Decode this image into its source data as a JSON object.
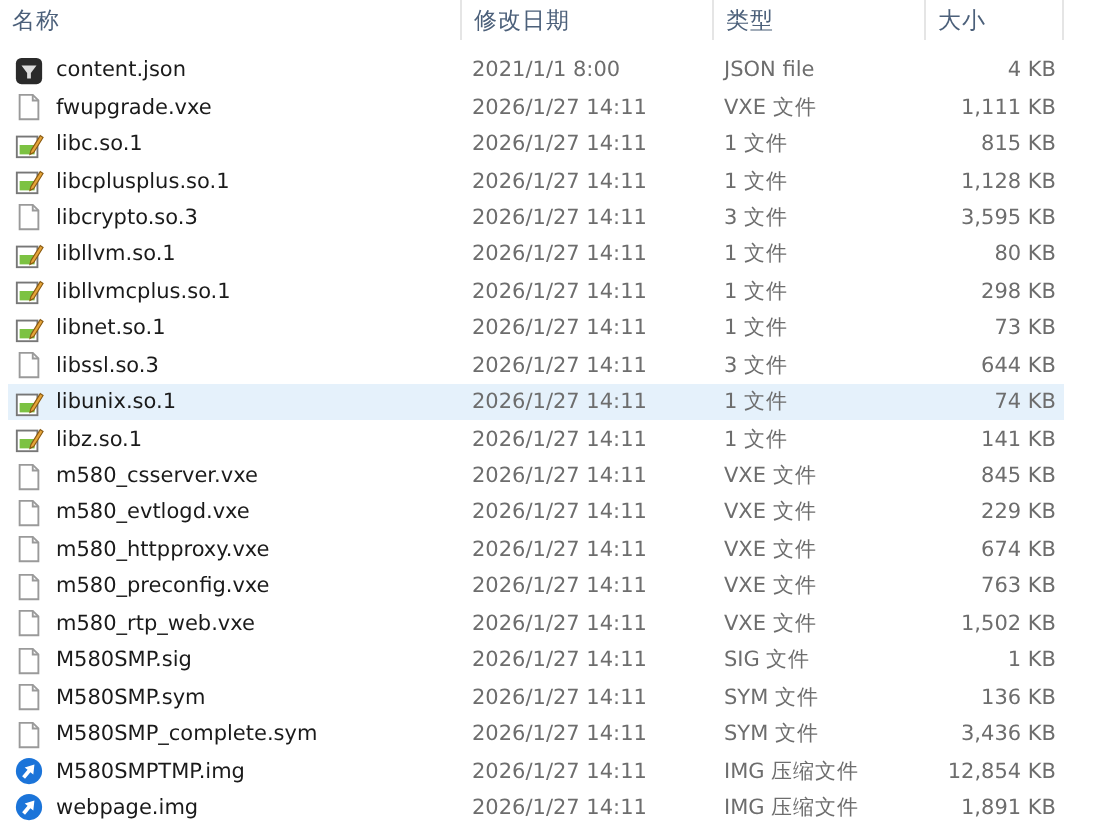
{
  "columns": [
    "名称",
    "修改日期",
    "类型",
    "大小"
  ],
  "rows": [
    {
      "kind": "json",
      "name": "content.json",
      "date": "2021/1/1 8:00",
      "type": "JSON file",
      "size": "4 KB",
      "selected": false
    },
    {
      "kind": "file",
      "name": "fwupgrade.vxe",
      "date": "2026/1/27 14:11",
      "type": "VXE 文件",
      "size": "1,111 KB",
      "selected": false
    },
    {
      "kind": "text",
      "name": "libc.so.1",
      "date": "2026/1/27 14:11",
      "type": "1 文件",
      "size": "815 KB",
      "selected": false
    },
    {
      "kind": "text",
      "name": "libcplusplus.so.1",
      "date": "2026/1/27 14:11",
      "type": "1 文件",
      "size": "1,128 KB",
      "selected": false
    },
    {
      "kind": "file",
      "name": "libcrypto.so.3",
      "date": "2026/1/27 14:11",
      "type": "3 文件",
      "size": "3,595 KB",
      "selected": false
    },
    {
      "kind": "text",
      "name": "libllvm.so.1",
      "date": "2026/1/27 14:11",
      "type": "1 文件",
      "size": "80 KB",
      "selected": false
    },
    {
      "kind": "text",
      "name": "libllvmcplus.so.1",
      "date": "2026/1/27 14:11",
      "type": "1 文件",
      "size": "298 KB",
      "selected": false
    },
    {
      "kind": "text",
      "name": "libnet.so.1",
      "date": "2026/1/27 14:11",
      "type": "1 文件",
      "size": "73 KB",
      "selected": false
    },
    {
      "kind": "file",
      "name": "libssl.so.3",
      "date": "2026/1/27 14:11",
      "type": "3 文件",
      "size": "644 KB",
      "selected": false
    },
    {
      "kind": "text",
      "name": "libunix.so.1",
      "date": "2026/1/27 14:11",
      "type": "1 文件",
      "size": "74 KB",
      "selected": true
    },
    {
      "kind": "text",
      "name": "libz.so.1",
      "date": "2026/1/27 14:11",
      "type": "1 文件",
      "size": "141 KB",
      "selected": false
    },
    {
      "kind": "file",
      "name": "m580_csserver.vxe",
      "date": "2026/1/27 14:11",
      "type": "VXE 文件",
      "size": "845 KB",
      "selected": false
    },
    {
      "kind": "file",
      "name": "m580_evtlogd.vxe",
      "date": "2026/1/27 14:11",
      "type": "VXE 文件",
      "size": "229 KB",
      "selected": false
    },
    {
      "kind": "file",
      "name": "m580_httpproxy.vxe",
      "date": "2026/1/27 14:11",
      "type": "VXE 文件",
      "size": "674 KB",
      "selected": false
    },
    {
      "kind": "file",
      "name": "m580_preconfig.vxe",
      "date": "2026/1/27 14:11",
      "type": "VXE 文件",
      "size": "763 KB",
      "selected": false
    },
    {
      "kind": "file",
      "name": "m580_rtp_web.vxe",
      "date": "2026/1/27 14:11",
      "type": "VXE 文件",
      "size": "1,502 KB",
      "selected": false
    },
    {
      "kind": "file",
      "name": "M580SMP.sig",
      "date": "2026/1/27 14:11",
      "type": "SIG 文件",
      "size": "1 KB",
      "selected": false
    },
    {
      "kind": "file",
      "name": "M580SMP.sym",
      "date": "2026/1/27 14:11",
      "type": "SYM 文件",
      "size": "136 KB",
      "selected": false
    },
    {
      "kind": "file",
      "name": "M580SMP_complete.sym",
      "date": "2026/1/27 14:11",
      "type": "SYM 文件",
      "size": "3,436 KB",
      "selected": false
    },
    {
      "kind": "disc",
      "name": "M580SMPTMP.img",
      "date": "2026/1/27 14:11",
      "type": "IMG 压缩文件",
      "size": "12,854 KB",
      "selected": false
    },
    {
      "kind": "disc",
      "name": "webpage.img",
      "date": "2026/1/27 14:11",
      "type": "IMG 压缩文件",
      "size": "1,891 KB",
      "selected": false
    }
  ]
}
